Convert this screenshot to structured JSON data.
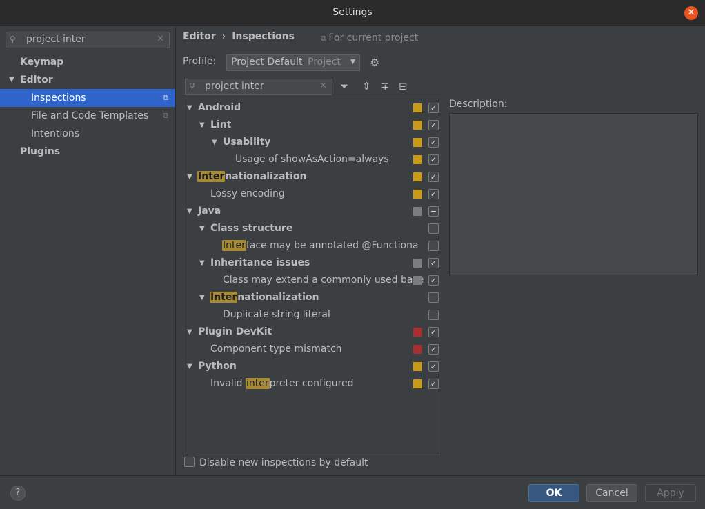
{
  "window": {
    "title": "Settings"
  },
  "sidebar": {
    "search_value": "project inter",
    "items": [
      {
        "label": "Keymap"
      },
      {
        "label": "Editor"
      },
      {
        "label": "Inspections"
      },
      {
        "label": "File and Code Templates"
      },
      {
        "label": "Intentions"
      },
      {
        "label": "Plugins"
      }
    ]
  },
  "header": {
    "breadcrumb": [
      "Editor",
      "Inspections"
    ],
    "scope_label": "For current project"
  },
  "profile": {
    "label": "Profile:",
    "value": "Project Default",
    "scope": "Project"
  },
  "tree_search": {
    "value": "project inter"
  },
  "tree": {
    "rows": [
      {
        "pre": "",
        "hl": "",
        "post": "Android"
      },
      {
        "pre": "",
        "hl": "",
        "post": "Lint"
      },
      {
        "pre": "",
        "hl": "",
        "post": "Usability"
      },
      {
        "pre": "",
        "hl": "",
        "post": "Usage of showAsAction=always"
      },
      {
        "pre": "",
        "hl": "Inter",
        "post": "nationalization"
      },
      {
        "pre": "",
        "hl": "",
        "post": "Lossy encoding"
      },
      {
        "pre": "",
        "hl": "",
        "post": "Java"
      },
      {
        "pre": "",
        "hl": "",
        "post": "Class structure"
      },
      {
        "pre": "",
        "hl": "Inter",
        "post": "face may be annotated @Functiona"
      },
      {
        "pre": "",
        "hl": "",
        "post": "Inheritance issues"
      },
      {
        "pre": "",
        "hl": "",
        "post": "Class may extend a commonly used base"
      },
      {
        "pre": "",
        "hl": "Inter",
        "post": "nationalization"
      },
      {
        "pre": "",
        "hl": "",
        "post": "Duplicate string literal"
      },
      {
        "pre": "",
        "hl": "",
        "post": "Plugin DevKit"
      },
      {
        "pre": "",
        "hl": "",
        "post": "Component type mismatch"
      },
      {
        "pre": "",
        "hl": "",
        "post": "Python"
      },
      {
        "pre": "Invalid ",
        "hl": "inter",
        "post": "preter configured"
      }
    ],
    "severity_colors": {
      "warning": "#c89a1c",
      "weak_warning": "#7c7c7c",
      "error": "#a82f2f"
    }
  },
  "description": {
    "label": "Description:"
  },
  "options": {
    "disable_new_label": "Disable new inspections by default"
  },
  "footer": {
    "help_label": "?",
    "ok_label": "OK",
    "cancel_label": "Cancel",
    "apply_label": "Apply"
  }
}
